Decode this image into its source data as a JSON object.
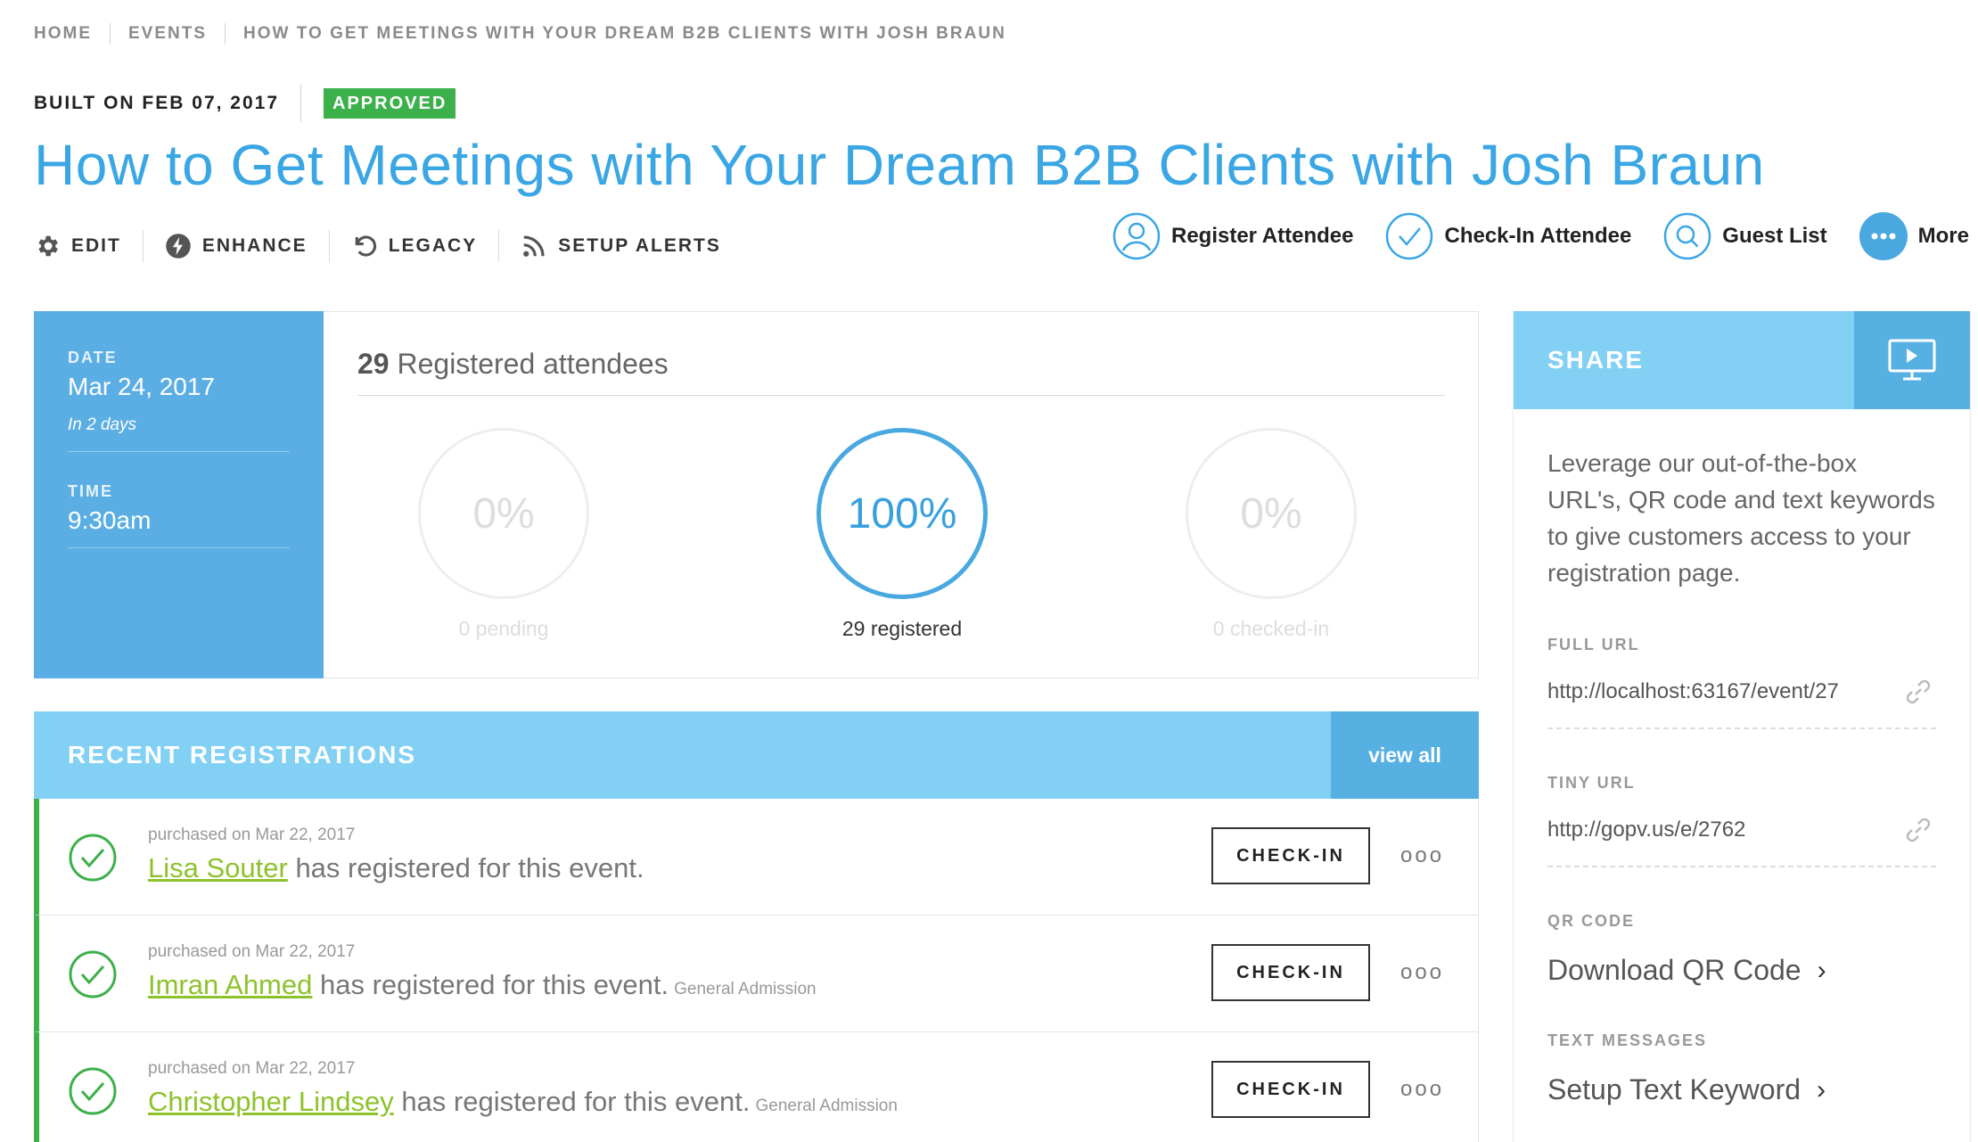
{
  "breadcrumb": [
    "HOME",
    "EVENTS",
    "HOW TO GET MEETINGS WITH YOUR DREAM B2B CLIENTS WITH JOSH BRAUN"
  ],
  "meta": {
    "built": "BUILT ON FEB 07, 2017",
    "status": "APPROVED"
  },
  "title": "How to Get Meetings with Your Dream B2B Clients with Josh Braun",
  "toolbar": {
    "edit": "EDIT",
    "enhance": "ENHANCE",
    "legacy": "LEGACY",
    "setup_alerts": "SETUP ALERTS"
  },
  "actions": {
    "register": "Register Attendee",
    "checkin": "Check-In Attendee",
    "guest_list": "Guest List",
    "more": "More"
  },
  "date_panel": {
    "date_label": "DATE",
    "date": "Mar 24, 2017",
    "relative": "In 2 days",
    "time_label": "TIME",
    "time": "9:30am"
  },
  "stats": {
    "count": "29",
    "heading_rest": "Registered attendees",
    "pending": {
      "percent": "0%",
      "label": "0 pending"
    },
    "registered": {
      "percent": "100%",
      "label": "29 registered"
    },
    "checked_in": {
      "percent": "0%",
      "label": "0 checked-in"
    }
  },
  "recent": {
    "title": "RECENT REGISTRATIONS",
    "view_all": "view all",
    "checkin_label": "CHECK-IN",
    "dots": "ooo",
    "rows": [
      {
        "date": "purchased on Mar 22, 2017",
        "name": "Lisa Souter",
        "text": " has registered for this event.",
        "type": ""
      },
      {
        "date": "purchased on Mar 22, 2017",
        "name": "Imran Ahmed",
        "text": " has registered for this event.",
        "type": "General Admission"
      },
      {
        "date": "purchased on Mar 22, 2017",
        "name": "Christopher Lindsey",
        "text": " has registered for this event.",
        "type": "General Admission"
      }
    ]
  },
  "share": {
    "title": "SHARE",
    "description": "Leverage our out-of-the-box URL's, QR code and text keywords to give customers access to your registration page.",
    "full_url_label": "FULL URL",
    "full_url": "http://localhost:63167/event/27",
    "tiny_url_label": "TINY URL",
    "tiny_url": "http://gopv.us/e/2762",
    "qr_label": "QR CODE",
    "qr_link": "Download QR Code",
    "text_label": "TEXT MESSAGES",
    "text_link": "Setup Text Keyword",
    "chevron": "›"
  },
  "colors": {
    "accent": "#3aa6e4",
    "approved": "#3cb04a",
    "panel_blue": "#5aaee3",
    "light_blue": "#82d1f4",
    "name_green": "#8dc22b"
  }
}
